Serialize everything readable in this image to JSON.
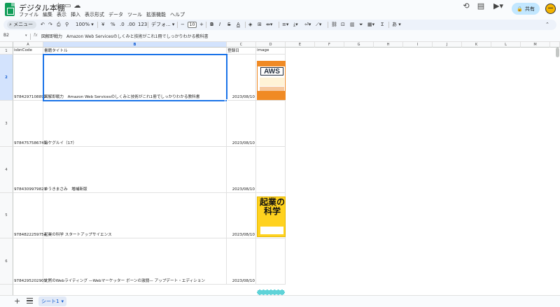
{
  "app": {
    "doc_title": "デジタル本棚",
    "menu": [
      "ファイル",
      "編集",
      "表示",
      "挿入",
      "表示形式",
      "データ",
      "ツール",
      "拡張機能",
      "ヘルプ"
    ],
    "share_label": "共有"
  },
  "toolbar": {
    "search_label": "メニュー",
    "zoom": "100%",
    "currency": "¥",
    "percent": "%",
    "dec_down": ".0",
    "dec_up": ".00",
    "number_format": "123",
    "font": "デフォ...",
    "font_size": "10",
    "bold": "B",
    "italic": "I",
    "strike": "S",
    "text_color": "A",
    "input_tools": "あ",
    "sum": "Σ"
  },
  "formula": {
    "name_box": "B2",
    "fx": "fx",
    "value": "図解即戦力　Amazon Web Servicesのしくみと技術がこれ1冊でしっかりわかる教科書"
  },
  "columns": [
    "A",
    "B",
    "C",
    "D",
    "E",
    "F",
    "G",
    "H",
    "I",
    "J",
    "K",
    "L",
    "M"
  ],
  "header_row": {
    "a": "isbnCode",
    "b": "書籍タイトル",
    "c": "登録日",
    "d": "image"
  },
  "rows": [
    {
      "num": "2",
      "isbn": "9784297108892",
      "title": "図解即戦力　Amazon Web Servicesのしくみと技術がこれ1冊でしっかりわかる教科書",
      "date": "2023/08/10"
    },
    {
      "num": "3",
      "isbn": "9784757586741",
      "title": "陰ケグルイ（17）",
      "date": "2023/08/10"
    },
    {
      "num": "4",
      "isbn": "9784309979823",
      "title": "ゆうきまさみ　増補新版",
      "date": "2023/08/10"
    },
    {
      "num": "5",
      "isbn": "9784822259754",
      "title": "起業の科学 スタートアップサイエンス",
      "date": "2023/08/10"
    },
    {
      "num": "6",
      "isbn": "9784295202905",
      "title": "沈黙のWebライティング —Webマーケッター ボーンの激闘— アップデート・エディション",
      "date": "2023/08/10"
    }
  ],
  "covers": {
    "aws_text": "AWS",
    "kigyo_text": "起業の科学"
  },
  "sheet_tab": "シート1"
}
